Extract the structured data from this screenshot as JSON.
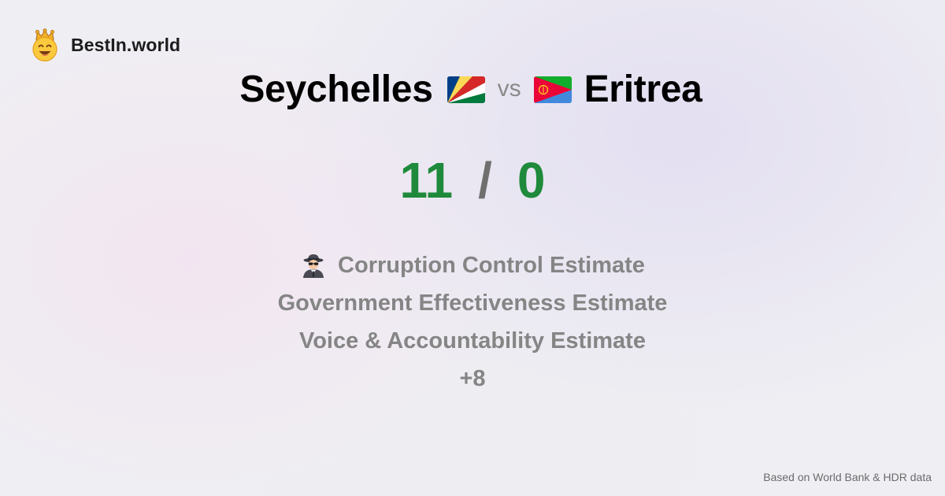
{
  "brand": {
    "name": "BestIn.world",
    "logo_icon": "smiling-face-with-crown-icon"
  },
  "comparison": {
    "country_a": "Seychelles",
    "country_b": "Eritrea",
    "vs_label": "vs",
    "flag_a_icon": "seychelles-flag-icon",
    "flag_b_icon": "eritrea-flag-icon"
  },
  "score": {
    "a": "11",
    "separator": "/",
    "b": "0",
    "color": "#1f8a3b"
  },
  "metrics": {
    "items": [
      {
        "icon": "spy-detective-icon",
        "label": "Corruption Control Estimate"
      },
      {
        "label": "Government Effectiveness Estimate"
      },
      {
        "label": "Voice & Accountability Estimate"
      }
    ],
    "more": "+8"
  },
  "footer": {
    "source": "Based on World Bank & HDR data"
  }
}
